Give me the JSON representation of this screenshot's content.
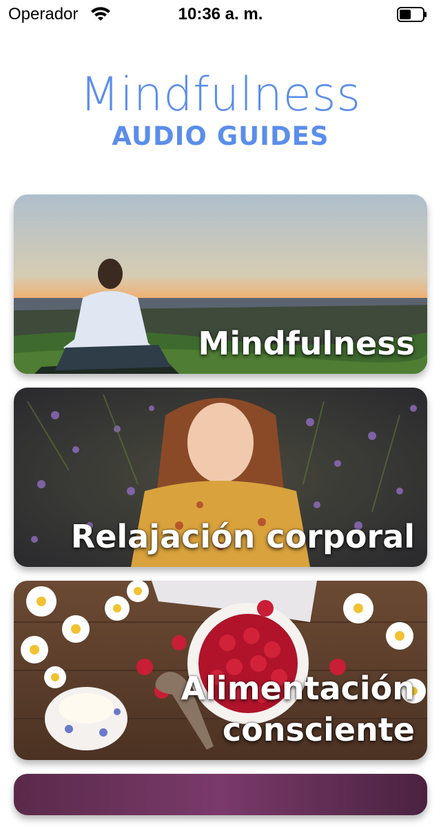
{
  "status_bar": {
    "carrier": "Operador",
    "time": "10:36 a. m.",
    "battery_level": 0.5
  },
  "header": {
    "title": "Mindfulness",
    "subtitle": "AUDIO GUIDES",
    "accent_color": "#5b8eea"
  },
  "cards": [
    {
      "title": "Mindfulness",
      "scene": "man meditating at sunset on grassy hill"
    },
    {
      "title": "Relajación corporal",
      "scene": "girl lying among lavender flowers"
    },
    {
      "title": "Alimentación consciente",
      "scene": "bowl of raspberries with daisies on wooden table"
    }
  ]
}
